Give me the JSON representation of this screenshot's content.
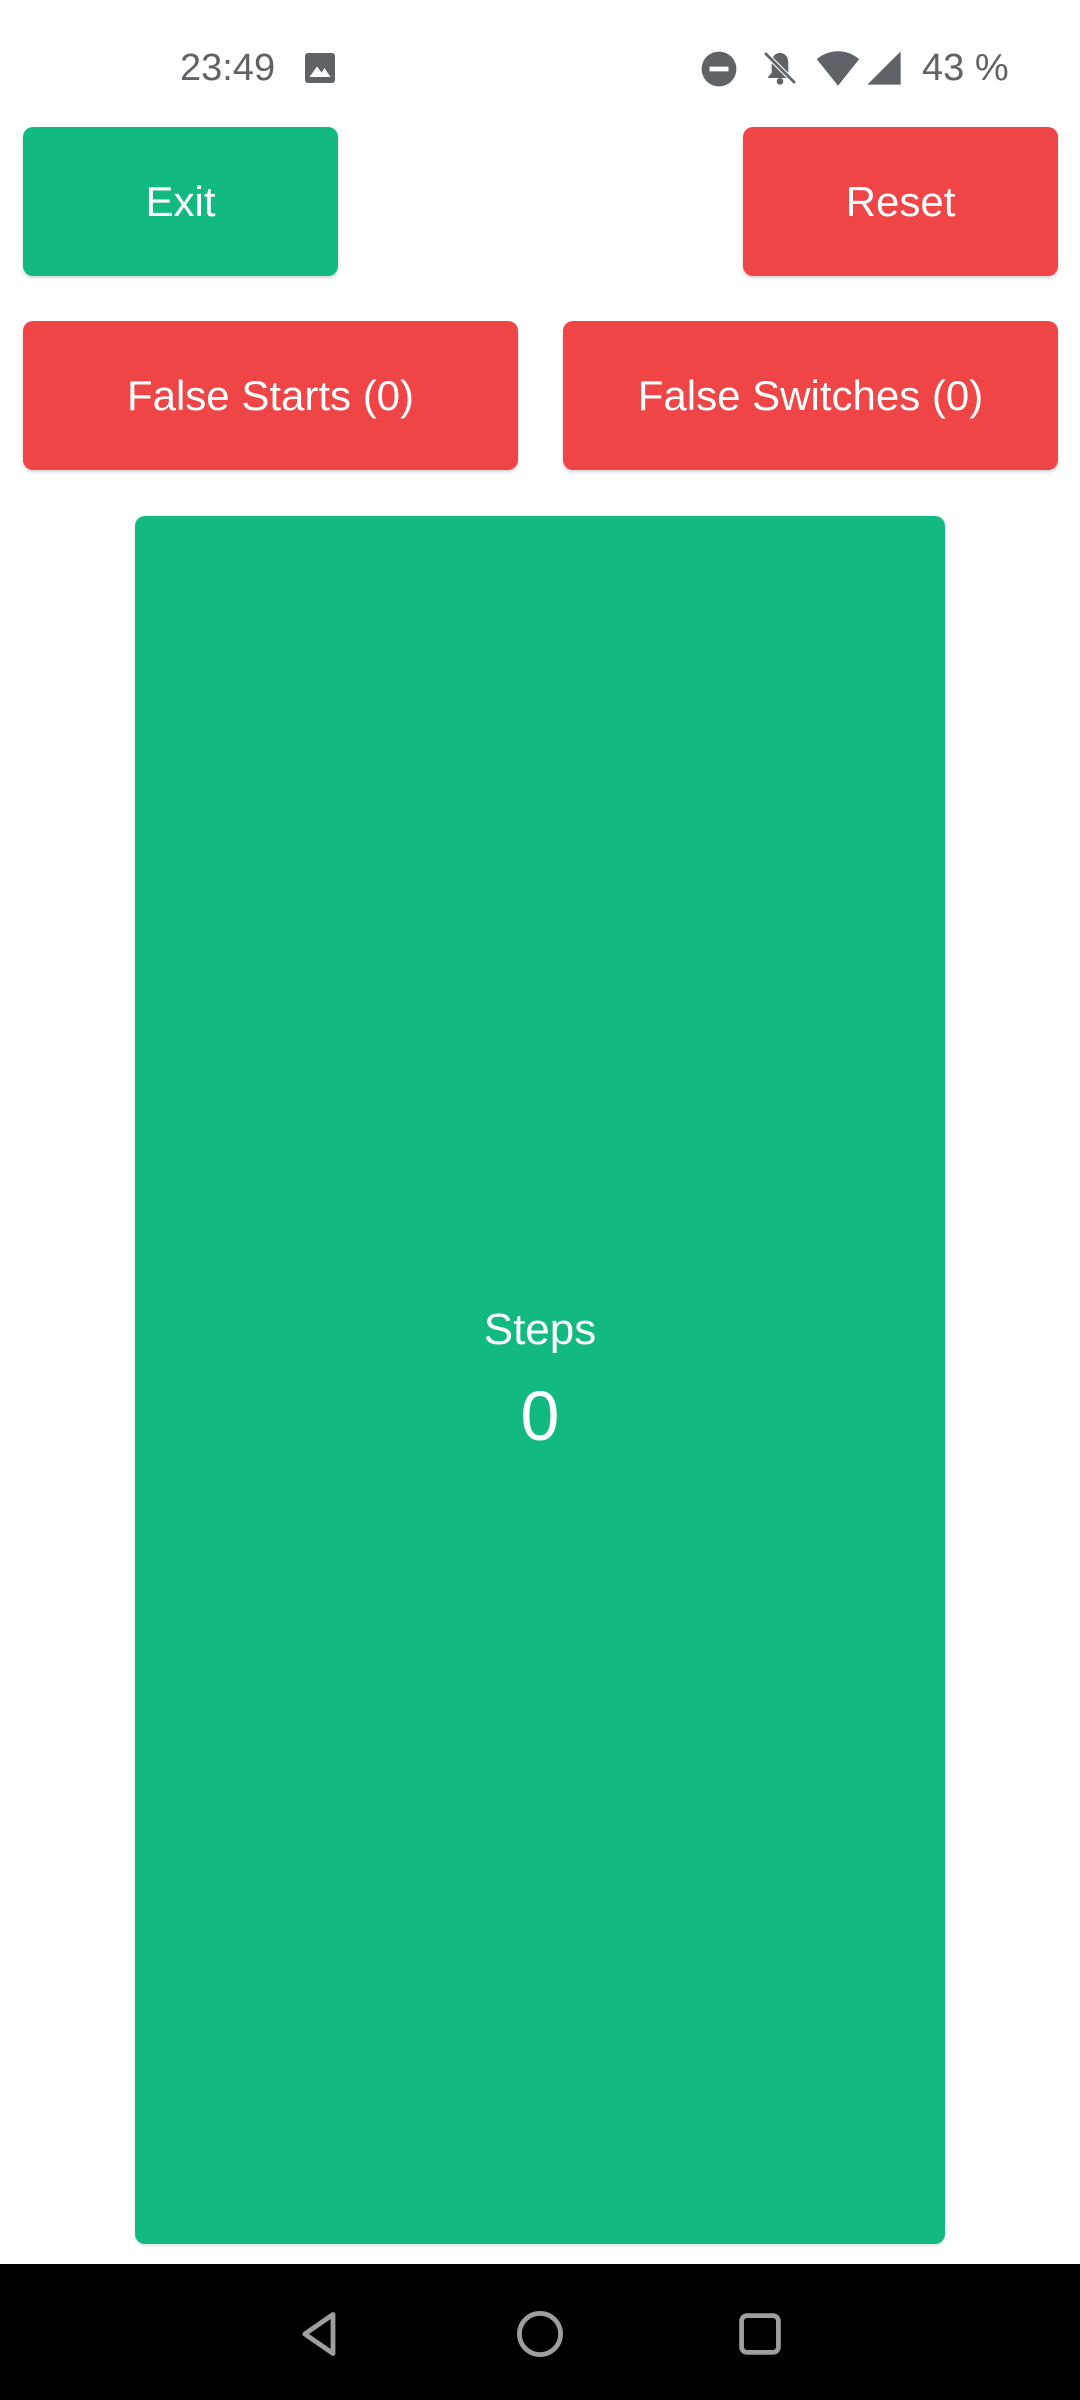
{
  "status_bar": {
    "time": "23:49",
    "battery": "43 %",
    "icons": [
      "image-icon",
      "do-not-disturb-icon",
      "bell-off-icon",
      "wifi-icon",
      "cell-signal-icon"
    ]
  },
  "toolbar": {
    "exit_label": "Exit",
    "reset_label": "Reset",
    "false_starts_label": "False Starts (0)",
    "false_switches_label": "False Switches (0)"
  },
  "counter": {
    "label": "Steps",
    "value": "0"
  },
  "nav_bar": {
    "icons": [
      "back-icon",
      "home-icon",
      "recents-icon"
    ]
  },
  "colors": {
    "green": "#12b981",
    "red": "#ef4546",
    "status_text": "#5f6368",
    "nav_background": "#000000"
  }
}
